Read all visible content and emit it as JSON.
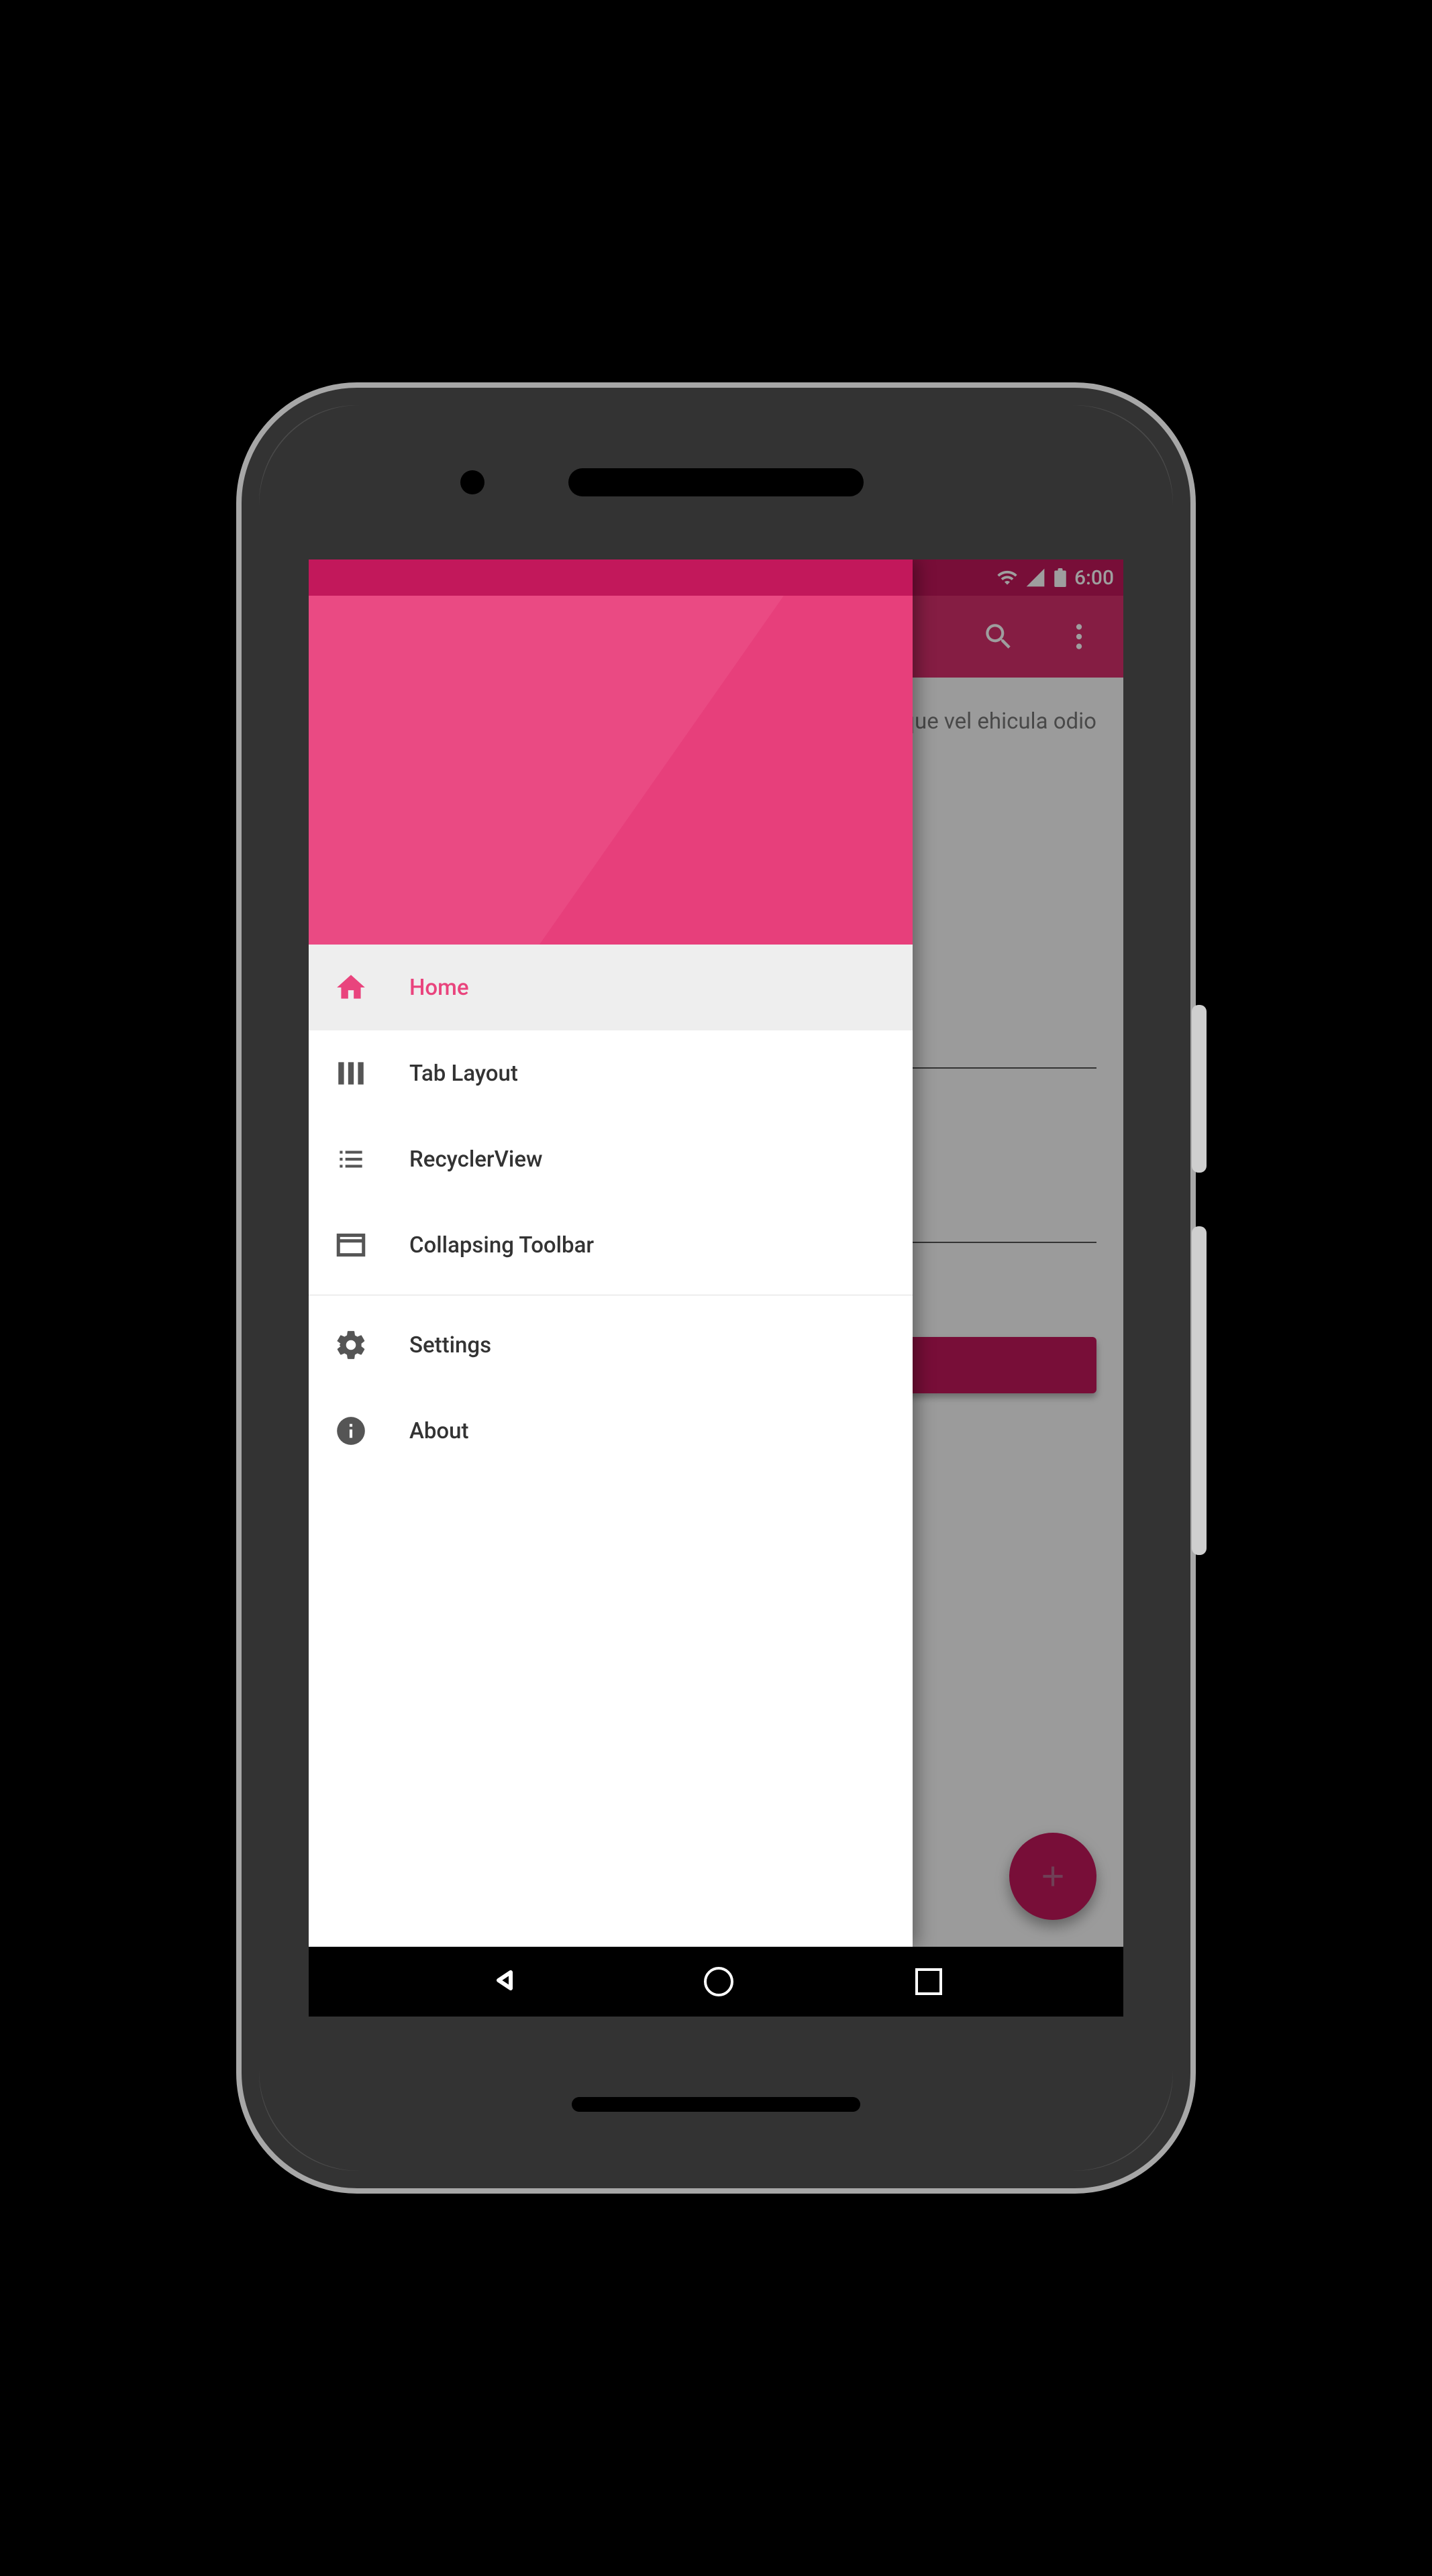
{
  "status_bar": {
    "time": "6:00"
  },
  "app_bar": {
    "title": ""
  },
  "drawer": {
    "items": [
      {
        "icon": "home",
        "label": "Home",
        "selected": true
      },
      {
        "icon": "tabs",
        "label": "Tab Layout",
        "selected": false
      },
      {
        "icon": "list",
        "label": "RecyclerView",
        "selected": false
      },
      {
        "icon": "toolbar",
        "label": "Collapsing Toolbar",
        "selected": false
      }
    ],
    "secondary": [
      {
        "icon": "gear",
        "label": "Settings"
      },
      {
        "icon": "info",
        "label": "About"
      }
    ]
  },
  "content": {
    "paragraph": "g elit. sque vel ehicula odio"
  },
  "fab": {
    "label": "+"
  },
  "button": {
    "label": ""
  }
}
